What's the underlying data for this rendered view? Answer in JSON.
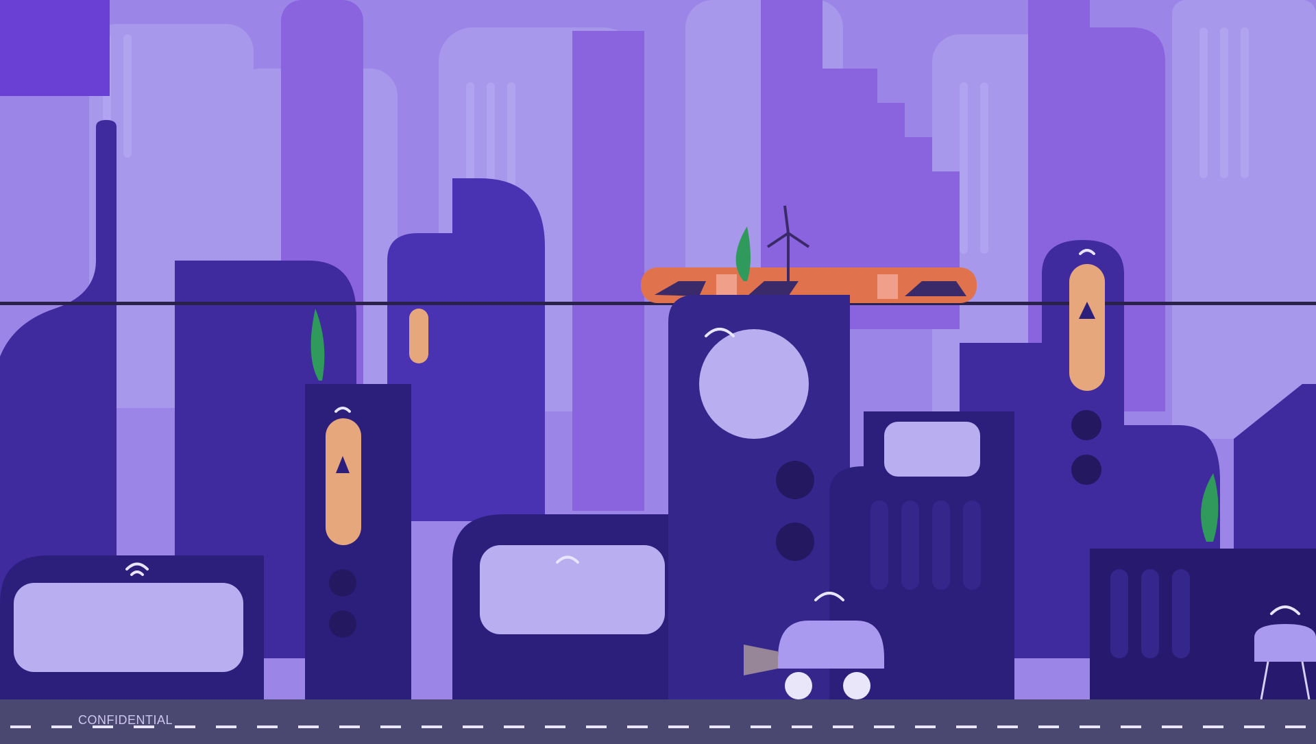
{
  "footer": {
    "label": "CONFIDENTIAL"
  },
  "palette": {
    "sky": "#9b86e8",
    "far": "#a898ec",
    "mid": "#8a63de",
    "near": "#3f2a9e",
    "front": "#2c1f7c",
    "road": "#4a4870",
    "accent": "#e6a77d",
    "train": "#e0724e"
  },
  "icons": [
    "wifi-icon",
    "lamp-icon",
    "plant-icon",
    "car-icon",
    "train-icon",
    "wind-turbine-icon",
    "grill-icon"
  ]
}
